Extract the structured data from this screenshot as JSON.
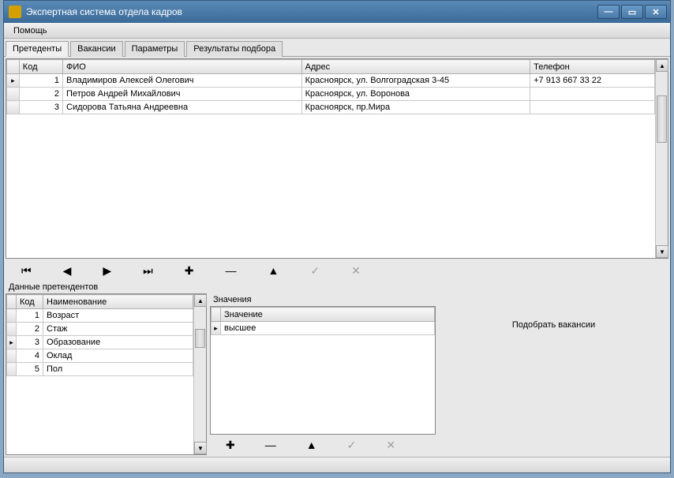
{
  "window": {
    "title": "Экспертная система отдела кадров"
  },
  "menu": {
    "help": "Помощь"
  },
  "tabs": {
    "t1": "Претеденты",
    "t2": "Вакансии",
    "t3": "Параметры",
    "t4": "Результаты подбора"
  },
  "applicants_grid": {
    "cols": {
      "code": "Код",
      "fio": "ФИО",
      "address": "Адрес",
      "phone": "Телефон"
    },
    "rows": [
      {
        "code": "1",
        "fio": "Владимиров Алексей Олегович",
        "address": "Красноярск, ул. Волгоградская 3-45",
        "phone": "+7 913 667 33 22"
      },
      {
        "code": "2",
        "fio": "Петров Андрей Михайлович",
        "address": "Красноярск, ул. Воронова",
        "phone": ""
      },
      {
        "code": "3",
        "fio": "Сидорова Татьяна Андреевна",
        "address": "Красноярск, пр.Мира",
        "phone": ""
      }
    ]
  },
  "bottom": {
    "label": "Данные претендентов",
    "values_label": "Значения"
  },
  "params_grid": {
    "cols": {
      "code": "Код",
      "name": "Наименование"
    },
    "rows": [
      {
        "code": "1",
        "name": "Возраст"
      },
      {
        "code": "2",
        "name": "Стаж"
      },
      {
        "code": "3",
        "name": "Образование"
      },
      {
        "code": "4",
        "name": "Оклад"
      },
      {
        "code": "5",
        "name": "Пол"
      }
    ]
  },
  "values_grid": {
    "col": "Значение",
    "rows": [
      {
        "val": "высшее"
      }
    ]
  },
  "action": {
    "select_vacancies": "Подобрать вакансии"
  }
}
